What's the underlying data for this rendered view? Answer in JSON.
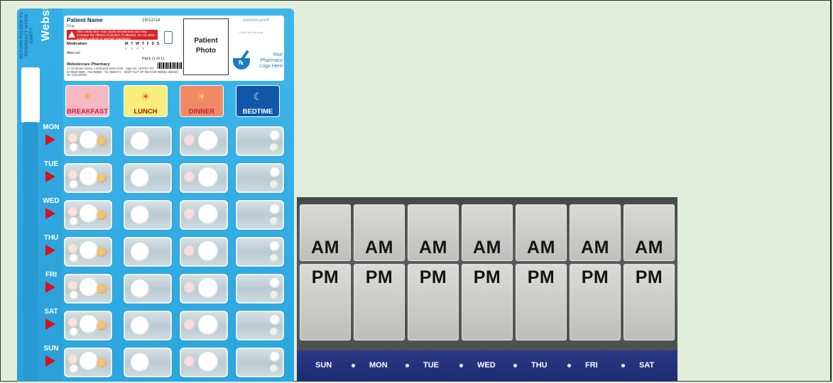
{
  "blister_pack": {
    "brand": "Webster-pak®",
    "return_note": "RETURN FOLDER TO PHARMACY WHEN EMPTY",
    "label": {
      "patient_name": "Patient Name",
      "date": "15/12/14",
      "drug": "Drug",
      "warning": "This medication may cause drowsiness and may increase the effects of alcohol. If affected, do not drive a motor vehicle or operate machinery",
      "medication": "Medication",
      "days": "M T W T F S S",
      "days_marks": "Y Y Y Y",
      "also_on": "Also on:",
      "pack": "Pack (1 of 1)",
      "pharmacy": "Webstercare Pharmacy",
      "address": "17-19 Moore Street, Leichhardt NSW 2040 · Appr No. 12976C Tel: 02 9560 8899 · Fax 90860 · Tel: 9560274 · KEEP OUT OF REACH OF CHILDREN",
      "barcode_number": "0 000021 402043"
    },
    "photo_box": "Patient Photo",
    "logo": {
      "brand": "webstercare®",
      "subtitle": "Good Care Everyday",
      "pharmacy_logo": "Your Pharmacy Logo Here"
    },
    "meals": [
      "BREAKFAST",
      "LUNCH",
      "DINNER",
      "BEDTIME"
    ],
    "days": [
      "MON",
      "TUE",
      "WED",
      "THU",
      "FRI",
      "SAT",
      "SUN"
    ]
  },
  "organizer": {
    "am_label": "AM",
    "pm_label": "PM",
    "days": [
      "SUN",
      "MON",
      "TUE",
      "WED",
      "THU",
      "FRI",
      "SAT"
    ]
  }
}
